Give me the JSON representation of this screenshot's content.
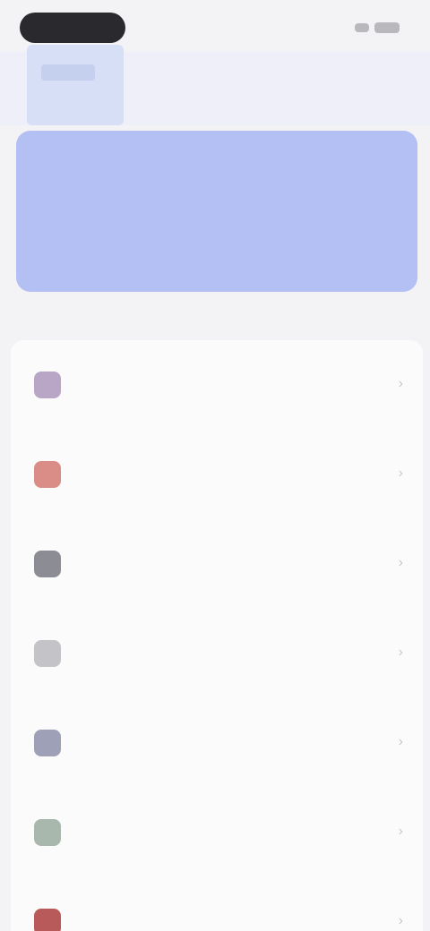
{
  "status_bar": {
    "time": ""
  },
  "hero": {
    "title": ""
  },
  "section": {
    "label": ""
  },
  "items": [
    {
      "label": "",
      "badge": "",
      "icon": "item-icon",
      "color": "#b9a6c6"
    },
    {
      "label": "",
      "icon": "item-icon",
      "color": "#d98d86"
    },
    {
      "label": "",
      "icon": "item-icon",
      "color": "#8c8c94"
    },
    {
      "label": "",
      "icon": "item-icon",
      "color": "#c4c4c8"
    },
    {
      "label": "",
      "icon": "item-icon",
      "color": "#9da0b6"
    },
    {
      "label": "",
      "icon": "item-icon",
      "color": "#a8b8ac"
    },
    {
      "label": "",
      "icon": "item-icon",
      "color": "#b85a5a"
    }
  ],
  "colors": {
    "hero_bg": "#b4bff4",
    "badge_bg": "#f2f08a"
  }
}
